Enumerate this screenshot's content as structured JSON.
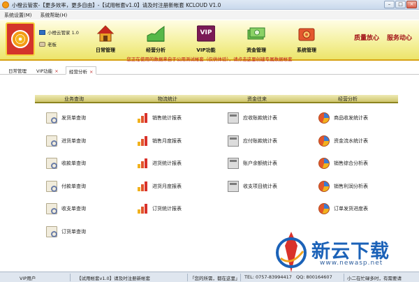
{
  "window": {
    "title": "小橙云管家-【更多效率，更多自由】-【试用帐套v1.0】请及时注册新帐套  KCLOUD V1.0",
    "buttons": {
      "minimize": "–",
      "maximize": "□",
      "close": "×"
    }
  },
  "menu": {
    "items": [
      "系统设置(M)",
      "系统帮助(H)"
    ]
  },
  "toolbar": {
    "product_name": "小橙云管家 1.0",
    "user_label": "老板",
    "tools": [
      "日常管理",
      "经营分析",
      "VIP功能",
      "资金管理",
      "系统管理"
    ],
    "vip_badge": "VIP",
    "right_links": [
      "质量放心",
      "服务动心"
    ]
  },
  "notice": "您正在使用的数据来自于公用测试帐套（仅供体验），请点击这里创建专属数据帐套",
  "tabs": [
    {
      "label": "日常管理",
      "active": false
    },
    {
      "label": "VIP功能",
      "active": false
    },
    {
      "label": "经营分析",
      "active": true
    }
  ],
  "tab_close_glyph": "×",
  "sections": [
    {
      "title": "业务查询",
      "icon": "doc",
      "items": [
        "发货单查询",
        "进货单查询",
        "收款单查询",
        "付款单查询",
        "收支单查询",
        "订货单查询"
      ]
    },
    {
      "title": "物流统计",
      "icon": "bar",
      "items": [
        "销售统计报表",
        "销售月度报表",
        "进货统计报表",
        "进货月度报表",
        "订货统计报表"
      ]
    },
    {
      "title": "资金往来",
      "icon": "calc",
      "items": [
        "应收账款统计表",
        "应付账款统计表",
        "账户余额统计表",
        "收支项目统计表"
      ]
    },
    {
      "title": "经营分析",
      "icon": "pie",
      "items": [
        "商品收发统计表",
        "资金流水统计表",
        "销售综合分析表",
        "销售利润分析表",
        "订单发货进度表"
      ]
    }
  ],
  "status": {
    "user": "VIP用户",
    "trial": "【试用帐套v1.0】请及时注册新帐套",
    "slogan": "「您的所需，都在这里」",
    "phone": "TEL: 0757-83994417",
    "qq": "QQ: 800164607",
    "tip": "小二在忙碌多时，有需要请"
  },
  "watermark": {
    "brand": "新云下载",
    "url": "www.newasp.net"
  },
  "colors": {
    "accent_red": "#c01818",
    "toolbar_yellow": "#f4f09a",
    "brand_blue": "#1b62b8"
  }
}
